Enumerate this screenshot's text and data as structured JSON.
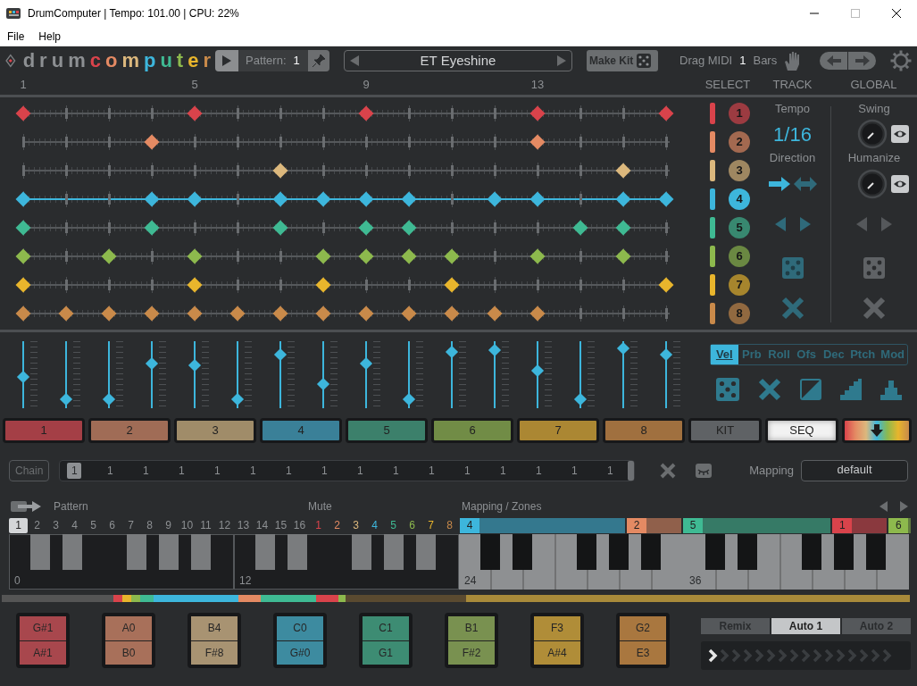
{
  "window": {
    "title": "DrumComputer | Tempo: 101.00 | CPU: 22%"
  },
  "menu": [
    "File",
    "Help"
  ],
  "header": {
    "logo": "drumcomputer",
    "pattern_label": "Pattern:",
    "pattern": "1",
    "preset": "ET Eyeshine",
    "make_kit": "Make Kit",
    "drag_midi": "Drag MIDI",
    "bars": "1",
    "bars_label": "Bars"
  },
  "ruler": {
    "beats": [
      "1",
      "5",
      "9",
      "13"
    ],
    "headings": [
      "SELECT",
      "TRACK",
      "GLOBAL"
    ]
  },
  "tracks": [
    {
      "number": "1",
      "color": "#d9434b",
      "selected": false,
      "steps": [
        true,
        false,
        false,
        false,
        true,
        false,
        false,
        false,
        true,
        false,
        false,
        false,
        true,
        false,
        false,
        true
      ]
    },
    {
      "number": "2",
      "color": "#e48a63",
      "selected": false,
      "steps": [
        false,
        false,
        false,
        true,
        false,
        false,
        false,
        false,
        false,
        false,
        false,
        false,
        true,
        false,
        false,
        false
      ]
    },
    {
      "number": "3",
      "color": "#dcb87d",
      "selected": false,
      "steps": [
        false,
        false,
        false,
        false,
        false,
        false,
        true,
        false,
        false,
        false,
        false,
        false,
        false,
        false,
        true,
        false
      ]
    },
    {
      "number": "4",
      "color": "#3db6dc",
      "selected": true,
      "steps": [
        true,
        false,
        false,
        true,
        true,
        false,
        true,
        true,
        true,
        true,
        false,
        true,
        true,
        false,
        true,
        true
      ]
    },
    {
      "number": "5",
      "color": "#3fba93",
      "selected": false,
      "steps": [
        true,
        false,
        false,
        true,
        false,
        false,
        true,
        false,
        true,
        true,
        false,
        false,
        false,
        true,
        true,
        false
      ]
    },
    {
      "number": "6",
      "color": "#8db94d",
      "selected": false,
      "steps": [
        true,
        false,
        true,
        false,
        true,
        false,
        false,
        true,
        true,
        true,
        true,
        false,
        true,
        false,
        true,
        false
      ]
    },
    {
      "number": "7",
      "color": "#e8b52c",
      "selected": false,
      "steps": [
        true,
        false,
        false,
        false,
        true,
        false,
        false,
        true,
        false,
        false,
        true,
        false,
        false,
        false,
        false,
        true
      ]
    },
    {
      "number": "8",
      "color": "#c98a4a",
      "selected": false,
      "steps": [
        true,
        true,
        true,
        true,
        true,
        true,
        true,
        true,
        true,
        true,
        true,
        true,
        true,
        false,
        false,
        false
      ]
    }
  ],
  "track_panel": {
    "tempo_label": "Tempo",
    "tempo": "1/16",
    "direction_label": "Direction"
  },
  "global_panel": {
    "swing_label": "Swing",
    "humanize_label": "Humanize"
  },
  "lane": {
    "tabs": [
      {
        "label": "Vel",
        "selected": true
      },
      {
        "label": "Prb",
        "selected": false
      },
      {
        "label": "Roll",
        "selected": false
      },
      {
        "label": "Ofs",
        "selected": false
      },
      {
        "label": "Dec",
        "selected": false
      },
      {
        "label": "Ptch",
        "selected": false
      },
      {
        "label": "Mod",
        "selected": false
      }
    ],
    "steps": [
      {
        "level": 0.46
      },
      {
        "level": 0.08
      },
      {
        "level": 0.08
      },
      {
        "level": 0.69
      },
      {
        "level": 0.66
      },
      {
        "level": 0.08
      },
      {
        "level": 0.85
      },
      {
        "level": 0.34
      },
      {
        "level": 0.69
      },
      {
        "level": 0.08
      },
      {
        "level": 0.89
      },
      {
        "level": 0.92
      },
      {
        "level": 0.57
      },
      {
        "level": 0.08
      },
      {
        "level": 0.95
      },
      {
        "level": 0.85
      }
    ]
  },
  "view_tabs": [
    {
      "label": "1",
      "kind": "track",
      "color": "#a43f46",
      "selected": false
    },
    {
      "label": "2",
      "kind": "track",
      "color": "#a06c56",
      "selected": false
    },
    {
      "label": "3",
      "kind": "track",
      "color": "#a08c69",
      "selected": false
    },
    {
      "label": "4",
      "kind": "track",
      "color": "#3a8098",
      "selected": false
    },
    {
      "label": "5",
      "kind": "track",
      "color": "#3c806b",
      "selected": false
    },
    {
      "label": "6",
      "kind": "track",
      "color": "#718c46",
      "selected": false
    },
    {
      "label": "7",
      "kind": "track",
      "color": "#ab8733",
      "selected": false
    },
    {
      "label": "8",
      "kind": "track",
      "color": "#a0703f",
      "selected": false
    },
    {
      "label": "KIT",
      "kind": "view",
      "selected": false
    },
    {
      "label": "SEQ",
      "kind": "view",
      "selected": true
    },
    {
      "kind": "palette",
      "selected": false
    }
  ],
  "chain": {
    "label": "Chain",
    "slots": [
      {
        "label": "1",
        "selected": true
      },
      {
        "label": "1",
        "selected": false
      },
      {
        "label": "1",
        "selected": false
      },
      {
        "label": "1",
        "selected": false
      },
      {
        "label": "1",
        "selected": false
      },
      {
        "label": "1",
        "selected": false
      },
      {
        "label": "1",
        "selected": false
      },
      {
        "label": "1",
        "selected": false
      },
      {
        "label": "1",
        "selected": false
      },
      {
        "label": "1",
        "selected": false
      },
      {
        "label": "1",
        "selected": false
      },
      {
        "label": "1",
        "selected": false
      },
      {
        "label": "1",
        "selected": false
      },
      {
        "label": "1",
        "selected": false
      },
      {
        "label": "1",
        "selected": false
      },
      {
        "label": "1",
        "selected": false
      }
    ]
  },
  "mapping": {
    "label": "Mapping",
    "value": "default"
  },
  "keys": {
    "pattern_label": "Pattern",
    "mute_label": "Mute",
    "zones_label": "Mapping / Zones",
    "pattern_keys": [
      {
        "label": "1",
        "selected": true
      },
      {
        "label": "2",
        "selected": false
      },
      {
        "label": "3",
        "selected": false
      },
      {
        "label": "4",
        "selected": false
      },
      {
        "label": "5",
        "selected": false
      },
      {
        "label": "6",
        "selected": false
      },
      {
        "label": "7",
        "selected": false
      },
      {
        "label": "8",
        "selected": false
      },
      {
        "label": "9",
        "selected": false
      },
      {
        "label": "10",
        "selected": false
      },
      {
        "label": "11",
        "selected": false
      },
      {
        "label": "12",
        "selected": false
      },
      {
        "label": "13",
        "selected": false
      },
      {
        "label": "14",
        "selected": false
      },
      {
        "label": "15",
        "selected": false
      },
      {
        "label": "16",
        "selected": false
      }
    ],
    "mute_keys": [
      {
        "label": "1",
        "color": "#d9434b"
      },
      {
        "label": "2",
        "color": "#e48a63"
      },
      {
        "label": "3",
        "color": "#dcb87d"
      },
      {
        "label": "4",
        "color": "#3db6dc"
      },
      {
        "label": "5",
        "color": "#3fba93"
      },
      {
        "label": "6",
        "color": "#8db94d"
      },
      {
        "label": "7",
        "color": "#e8b52c"
      },
      {
        "label": "8",
        "color": "#c98a4a"
      }
    ],
    "zones": [
      {
        "label": "4",
        "color": "#3db6dc"
      },
      {
        "label": "2",
        "color": "#e48a63"
      },
      {
        "label": "5",
        "color": "#3fba93"
      },
      {
        "label": "1",
        "color": "#d9434b"
      },
      {
        "label": "6",
        "color": "#8db94d"
      }
    ],
    "octaves": [
      {
        "label": "0",
        "kind": "pattern"
      },
      {
        "label": "12",
        "kind": "pattern"
      },
      {
        "label": "24",
        "kind": "zone"
      },
      {
        "label": "36",
        "kind": "zone"
      }
    ]
  },
  "pads": [
    {
      "top": "G#1",
      "bottom": "A#1",
      "color": "#a8474d"
    },
    {
      "top": "A0",
      "bottom": "B0",
      "color": "#a8705a"
    },
    {
      "top": "B4",
      "bottom": "F#8",
      "color": "#a89372"
    },
    {
      "top": "C0",
      "bottom": "G#0",
      "color": "#3d8ba0"
    },
    {
      "top": "C1",
      "bottom": "G1",
      "color": "#3d8c73"
    },
    {
      "top": "B1",
      "bottom": "F#2",
      "color": "#799150"
    },
    {
      "top": "F3",
      "bottom": "A#4",
      "color": "#b08d38"
    },
    {
      "top": "G2",
      "bottom": "E3",
      "color": "#a9773f"
    }
  ],
  "auto_tabs": [
    {
      "label": "Remix",
      "selected": false
    },
    {
      "label": "Auto 1",
      "selected": true
    },
    {
      "label": "Auto 2",
      "selected": false
    }
  ]
}
